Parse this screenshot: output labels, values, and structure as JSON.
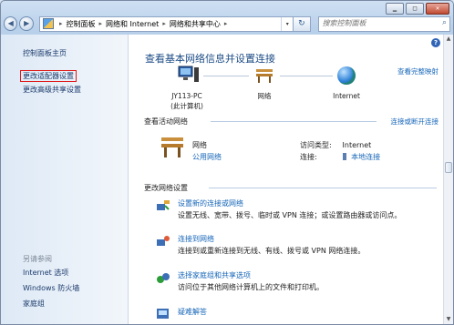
{
  "window": {
    "min_glyph": "▁",
    "max_glyph": "□",
    "close_glyph": "✕"
  },
  "nav": {
    "back_glyph": "◀",
    "forward_glyph": "▶",
    "recent_glyph": "▾",
    "crumbs": [
      "控制面板",
      "网络和 Internet",
      "网络和共享中心"
    ],
    "crumb_sep": "▸",
    "refresh_glyph": "↻",
    "search_placeholder": "搜索控制面板",
    "search_glyph": "⌕"
  },
  "sidebar": {
    "items": [
      {
        "label": "控制面板主页"
      },
      {
        "label": "更改适配器设置"
      },
      {
        "label": "更改高级共享设置"
      }
    ],
    "see_also": "另请参阅",
    "see_also_items": [
      {
        "label": "Internet 选项"
      },
      {
        "label": "Windows 防火墙"
      },
      {
        "label": "家庭组"
      }
    ]
  },
  "main": {
    "title": "查看基本网络信息并设置连接",
    "view_full_map": "查看完整映射",
    "map": {
      "pc_name": "JY113-PC",
      "pc_sub": "(此计算机)",
      "network": "网络",
      "internet": "Internet"
    },
    "active_header": "查看活动网络",
    "connect_disconnect": "连接或断开连接",
    "active": {
      "name": "网络",
      "type": "公用网络",
      "access_label": "访问类型:",
      "access_value": "Internet",
      "conn_label": "连接:",
      "conn_value": "本地连接"
    },
    "change_header": "更改网络设置",
    "tasks": [
      {
        "title": "设置新的连接或网络",
        "desc": "设置无线、宽带、拨号、临时或 VPN 连接；或设置路由器或访问点。"
      },
      {
        "title": "连接到网络",
        "desc": "连接到或重新连接到无线、有线、拨号或 VPN 网络连接。"
      },
      {
        "title": "选择家庭组和共享选项",
        "desc": "访问位于其他网络计算机上的文件和打印机。"
      },
      {
        "title": "疑难解答",
        "desc": ""
      }
    ]
  },
  "colors": {
    "link": "#1666b9",
    "title": "#1d4c86",
    "highlight_border": "#e01818"
  }
}
